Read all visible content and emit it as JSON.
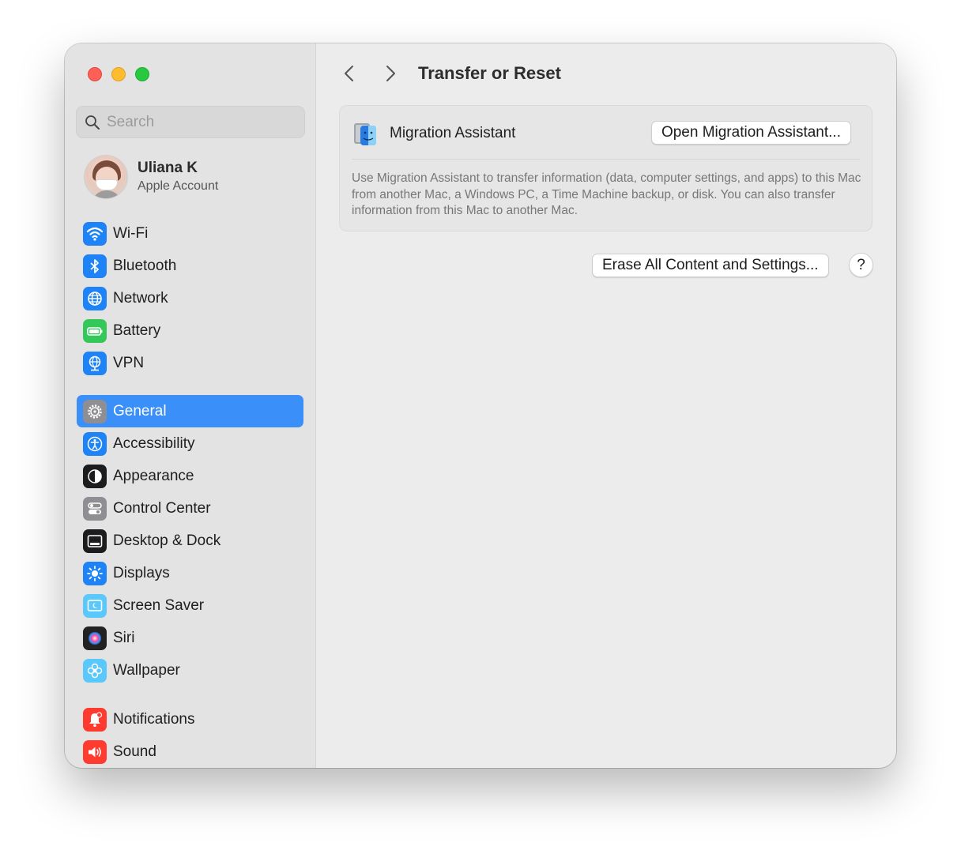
{
  "sidebar": {
    "search_placeholder": "Search",
    "account": {
      "name": "Uliana K",
      "subtitle": "Apple Account"
    },
    "groups": [
      [
        {
          "label": "Wi-Fi",
          "icon": "wifi-icon",
          "color": "#1e83f7"
        },
        {
          "label": "Bluetooth",
          "icon": "bluetooth-icon",
          "color": "#1e83f7"
        },
        {
          "label": "Network",
          "icon": "globe-icon",
          "color": "#1e83f7"
        },
        {
          "label": "Battery",
          "icon": "battery-icon",
          "color": "#34c759"
        },
        {
          "label": "VPN",
          "icon": "vpn-globe-icon",
          "color": "#1e83f7"
        }
      ],
      [
        {
          "label": "General",
          "icon": "gear-icon",
          "color": "#8e8e93",
          "selected": true
        },
        {
          "label": "Accessibility",
          "icon": "accessibility-icon",
          "color": "#1e83f7"
        },
        {
          "label": "Appearance",
          "icon": "appearance-icon",
          "color": "#1c1c1e"
        },
        {
          "label": "Control Center",
          "icon": "control-center-icon",
          "color": "#8e8e93"
        },
        {
          "label": "Desktop & Dock",
          "icon": "dock-icon",
          "color": "#1c1c1e"
        },
        {
          "label": "Displays",
          "icon": "sun-icon",
          "color": "#1e83f7"
        },
        {
          "label": "Screen Saver",
          "icon": "screen-saver-icon",
          "color": "#5ac8fa"
        },
        {
          "label": "Siri",
          "icon": "siri-icon",
          "color": "#222222"
        },
        {
          "label": "Wallpaper",
          "icon": "flower-icon",
          "color": "#5ac8fa"
        }
      ],
      [
        {
          "label": "Notifications",
          "icon": "bell-icon",
          "color": "#ff3b30"
        },
        {
          "label": "Sound",
          "icon": "speaker-icon",
          "color": "#ff3b30"
        }
      ]
    ]
  },
  "main": {
    "title": "Transfer or Reset",
    "migration": {
      "label": "Migration Assistant",
      "button": "Open Migration Assistant...",
      "description": "Use Migration Assistant to transfer information (data, computer settings, and apps) to this Mac from another Mac, a Windows PC, a Time Machine backup, or disk. You can also transfer information from this Mac to another Mac."
    },
    "erase_button": "Erase All Content and Settings...",
    "help_label": "?"
  },
  "colors": {
    "accent": "#3a8ff8",
    "sidebar_bg": "#e3e3e3",
    "main_bg": "#ececec"
  }
}
